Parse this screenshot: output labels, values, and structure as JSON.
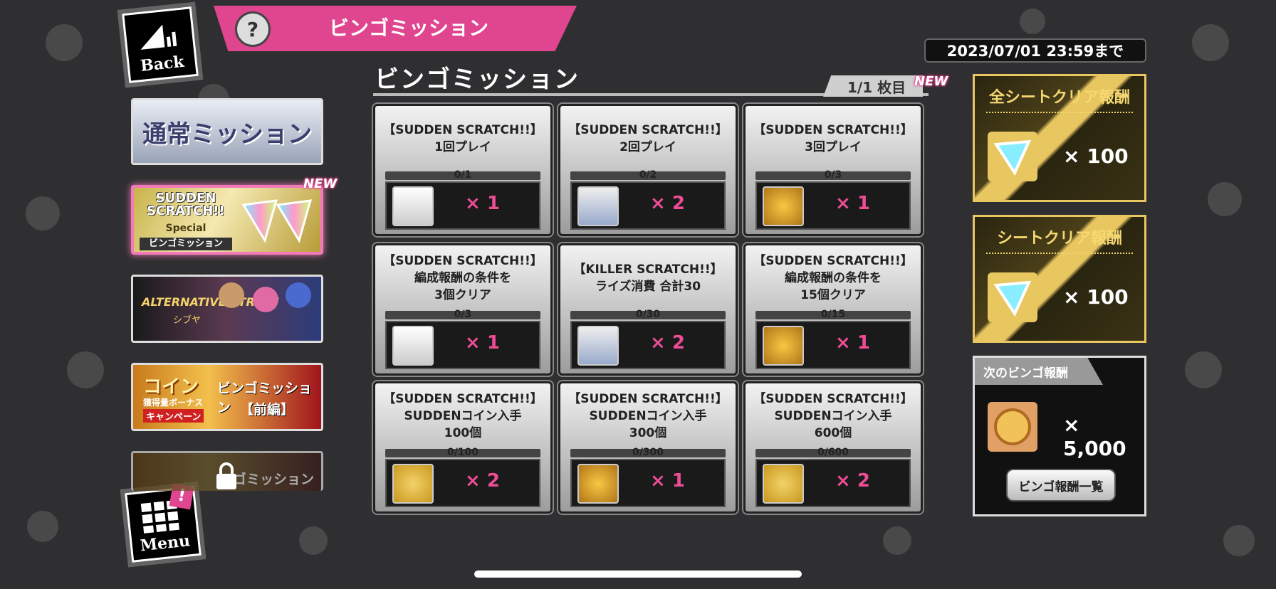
{
  "nav": {
    "back_label": "Back",
    "menu_label": "Menu"
  },
  "header": {
    "help_glyph": "?",
    "title": "ビンゴミッション"
  },
  "deadline": "2023/07/01 23:59まで",
  "section": {
    "title": "ビンゴミッション",
    "pager": "1/1 枚目",
    "new_badge": "NEW"
  },
  "left_menu": {
    "normal_label": "通常ミッション",
    "sudden_new_badge": "NEW",
    "sudden_banner_text": [
      "SUDDEN SCRATCH!!",
      "Special",
      "ビンゴミッション"
    ],
    "alt_banner_text": [
      "ALTERNATIVE STREET",
      "シブヤ"
    ],
    "coin_banner_text": [
      "コイン",
      "獲得量ボーナス",
      "キャンペーン",
      "ビンゴミッション",
      "【前編】"
    ],
    "locked_banner_text": "ゴミッション"
  },
  "missions": [
    {
      "title": [
        "【SUDDEN SCRATCH!!】",
        "1回プレイ"
      ],
      "progress": "0/1",
      "reward_icon": "green-can-icon",
      "qty": "× 1"
    },
    {
      "title": [
        "【SUDDEN SCRATCH!!】",
        "2回プレイ"
      ],
      "progress": "0/2",
      "reward_icon": "card-pack-icon",
      "qty": "× 2"
    },
    {
      "title": [
        "【SUDDEN SCRATCH!!】",
        "3回プレイ"
      ],
      "progress": "0/3",
      "reward_icon": "gold-medal-icon",
      "qty": "× 1"
    },
    {
      "title": [
        "【SUDDEN SCRATCH!!】",
        "編成報酬の条件を",
        "3個クリア"
      ],
      "progress": "0/3",
      "reward_icon": "green-can-icon",
      "qty": "× 1"
    },
    {
      "title": [
        "【KILLER SCRATCH!!】",
        "ライズ消費 合計30"
      ],
      "progress": "0/30",
      "reward_icon": "card-pack-icon",
      "qty": "× 2"
    },
    {
      "title": [
        "【SUDDEN SCRATCH!!】",
        "編成報酬の条件を",
        "15個クリア"
      ],
      "progress": "0/15",
      "reward_icon": "gold-medal-icon",
      "qty": "× 1"
    },
    {
      "title": [
        "【SUDDEN SCRATCH!!】",
        "SUDDENコイン入手",
        "100個"
      ],
      "progress": "0/100",
      "reward_icon": "silver-emblem-icon",
      "qty": "× 2"
    },
    {
      "title": [
        "【SUDDEN SCRATCH!!】",
        "SUDDENコイン入手",
        "300個"
      ],
      "progress": "0/300",
      "reward_icon": "gold-medal-icon",
      "qty": "× 1"
    },
    {
      "title": [
        "【SUDDEN SCRATCH!!】",
        "SUDDENコイン入手",
        "600個"
      ],
      "progress": "0/600",
      "reward_icon": "silver-emblem-icon",
      "qty": "× 2"
    }
  ],
  "right_panel": {
    "all_sheet_title": "全シートクリア報酬",
    "all_sheet_qty": "× 100",
    "sheet_title": "シートクリア報酬",
    "sheet_qty": "× 100",
    "next_title": "次のビンゴ報酬",
    "next_qty": "× 5,000",
    "list_button": "ビンゴ報酬一覧"
  },
  "colors": {
    "accent_pink": "#e0468f",
    "qty_pink": "#ec4d95",
    "gold": "#e8c660"
  }
}
